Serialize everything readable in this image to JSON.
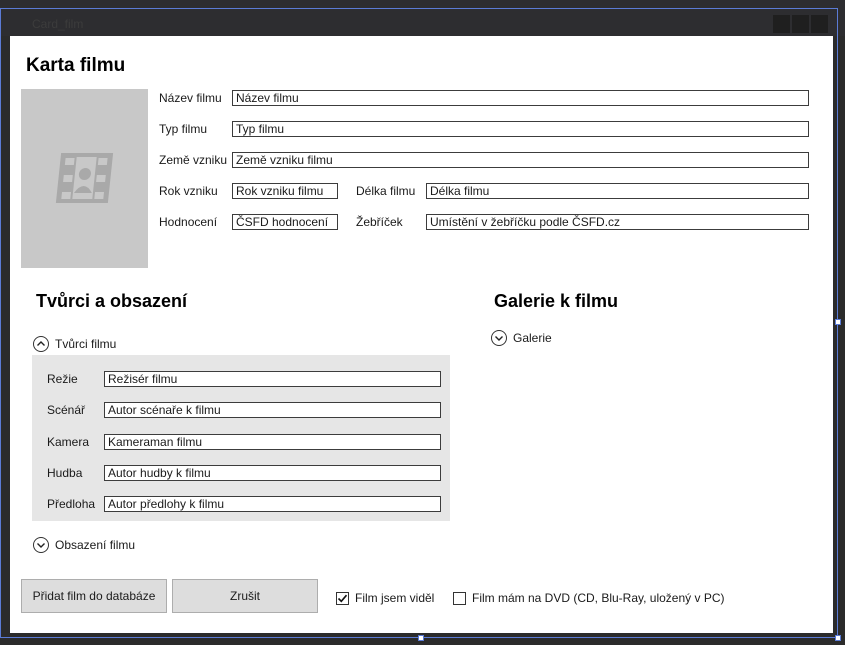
{
  "window": {
    "title": "Card_film"
  },
  "header": {
    "title": "Karta filmu"
  },
  "film": {
    "name": {
      "label": "Název filmu",
      "value": "Název filmu"
    },
    "type": {
      "label": "Typ filmu",
      "value": "Typ filmu"
    },
    "country": {
      "label": "Země vzniku",
      "value": "Země vzniku filmu"
    },
    "year": {
      "label": "Rok vzniku",
      "value": "Rok vzniku filmu"
    },
    "length": {
      "label": "Délka filmu",
      "value": "Délka filmu"
    },
    "rating": {
      "label": "Hodnocení",
      "value": "ČSFD hodnocení"
    },
    "rank": {
      "label": "Žebříček",
      "value": "Umístění v žebříčku podle ČSFD.cz"
    }
  },
  "creators_section": {
    "title": "Tvůrci a obsazení",
    "creators_expander": "Tvůrci filmu",
    "cast_expander": "Obsazení filmu",
    "rows": [
      {
        "label": "Režie",
        "value": "Režisér filmu"
      },
      {
        "label": "Scénář",
        "value": "Autor scénaře k filmu"
      },
      {
        "label": "Kamera",
        "value": "Kameraman filmu"
      },
      {
        "label": "Hudba",
        "value": "Autor hudby k filmu"
      },
      {
        "label": "Předloha",
        "value": "Autor předlohy k filmu"
      }
    ]
  },
  "gallery_section": {
    "title": "Galerie k filmu",
    "expander": "Galerie"
  },
  "footer": {
    "add_button": "Přidat film do databáze",
    "cancel_button": "Zrušit",
    "seen_label": "Film jsem viděl",
    "seen_checked": true,
    "dvd_label": "Film mám na DVD (CD, Blu-Ray, uložený v PC)",
    "dvd_checked": false
  },
  "icons": {
    "poster": "film-person-icon",
    "expand_up": "chevron-up-icon",
    "expand_down": "chevron-down-icon",
    "check": "checkmark-icon"
  },
  "colors": {
    "accent_selection": "#5b7bd5",
    "panel_bg": "#e6e6e6",
    "button_bg": "#dddddd"
  }
}
